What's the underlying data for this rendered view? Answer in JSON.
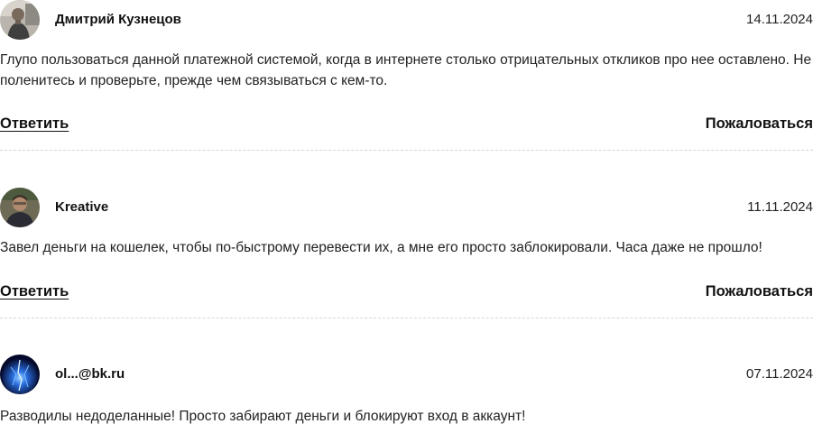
{
  "comments": [
    {
      "author": "Дмитрий Кузнецов",
      "date": "14.11.2024",
      "text": "Глупо пользоваться данной платежной системой, когда в интернете столько отрицательных откликов про нее оставлено. Не поленитесь и проверьте, прежде чем связываться с кем-то.",
      "reply_label": "Ответить",
      "report_label": "Пожаловаться"
    },
    {
      "author": "Kreative",
      "date": "11.11.2024",
      "text": "Завел деньги на кошелек, чтобы по-быстрому перевести их, а мне его просто заблокировали. Часа даже не прошло!",
      "reply_label": "Ответить",
      "report_label": "Пожаловаться"
    },
    {
      "author": "ol...@bk.ru",
      "date": "07.11.2024",
      "text": "Разводилы недоделанные! Просто забирают деньги и блокируют вход в аккаунт!"
    }
  ]
}
